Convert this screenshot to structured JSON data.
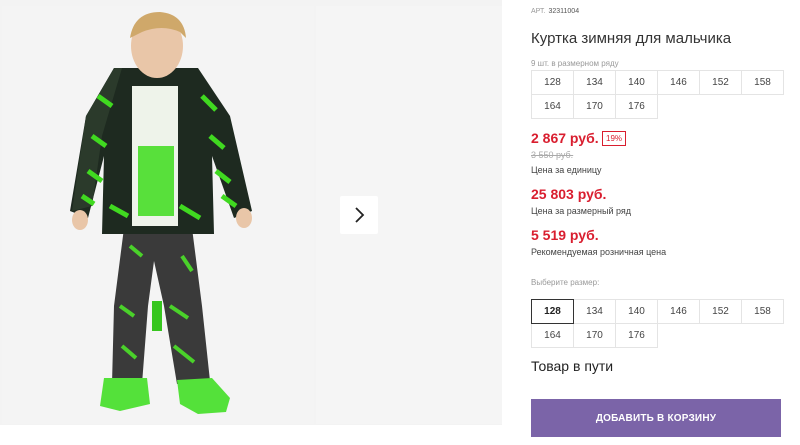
{
  "product": {
    "article_label": "АРТ.",
    "article_code": "32311004",
    "title": "Куртка зимняя для мальчика",
    "range_note": "9 шт. в размерном ряду",
    "range_sizes": [
      "128",
      "134",
      "140",
      "146",
      "152",
      "158",
      "164",
      "170",
      "176"
    ],
    "price_unit": "2 867 руб.",
    "discount": "19%",
    "old_price": "3 550 руб.",
    "price_unit_caption": "Цена за единицу",
    "price_range": "25 803 руб.",
    "price_range_caption": "Цена за размерный ряд",
    "price_retail": "5 519 руб.",
    "price_retail_caption": "Рекомендуемая розничная цена",
    "choose_size_label": "Выберите размер:",
    "choose_sizes": [
      "128",
      "134",
      "140",
      "146",
      "152",
      "158",
      "164",
      "170",
      "176"
    ],
    "selected_size": "128",
    "status": "Товар в пути",
    "cart_button": "ДОБАВИТЬ В КОРЗИНУ"
  },
  "colors": {
    "price_red": "#d91e2f",
    "button_purple": "#7b64a8",
    "jacket_green": "#39d622"
  },
  "icons": {
    "next": "chevron-right-icon"
  }
}
